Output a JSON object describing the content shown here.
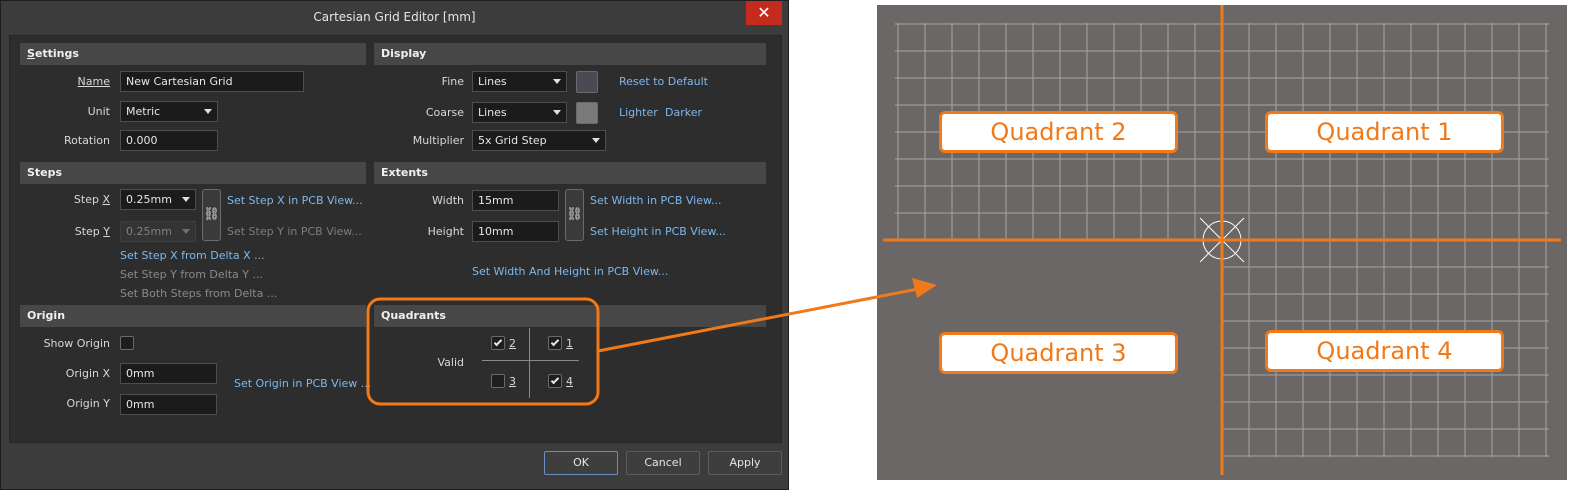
{
  "dialog": {
    "title": "Cartesian Grid Editor [mm]",
    "close_label": "✕"
  },
  "settings": {
    "header": "Settings",
    "name_label": "Name",
    "name_value": "New Cartesian Grid",
    "unit_label": "Unit",
    "unit_value": "Metric",
    "rotation_label": "Rotation",
    "rotation_value": "0.000"
  },
  "display": {
    "header": "Display",
    "fine_label": "Fine",
    "fine_value": "Lines",
    "coarse_label": "Coarse",
    "coarse_value": "Lines",
    "multiplier_label": "Multiplier",
    "multiplier_value": "5x Grid Step",
    "reset_link": "Reset to Default",
    "lighter_link": "Lighter",
    "darker_link": "Darker",
    "fine_color": "#4a4a55",
    "coarse_color": "#7a7a7a"
  },
  "steps": {
    "header": "Steps",
    "step_x_label_prefix": "Step ",
    "step_x_label_key": "X",
    "step_x_value": "0.25mm",
    "step_y_label_prefix": "Step ",
    "step_y_label_key": "Y",
    "step_y_value": "0.25mm",
    "set_x_pcb": "Set Step X in PCB View...",
    "set_y_pcb": "Set Step Y in PCB View...",
    "set_x_delta": "Set Step X from Delta X ...",
    "set_y_delta": "Set Step Y from Delta Y ...",
    "set_both_delta": "Set Both Steps from Delta ..."
  },
  "extents": {
    "header": "Extents",
    "width_label": "Width",
    "width_value": "15mm",
    "height_label": "Height",
    "height_value": "10mm",
    "set_width_pcb": "Set Width in PCB View...",
    "set_height_pcb": "Set Height in PCB View...",
    "set_both_pcb": "Set Width And Height in PCB View..."
  },
  "origin": {
    "header": "Origin",
    "show_label": "Show Origin",
    "show_checked": false,
    "x_label": "Origin X",
    "x_value": "0mm",
    "y_label": "Origin Y",
    "y_value": "0mm",
    "set_pcb": "Set Origin in PCB View ..."
  },
  "quadrants": {
    "header": "Quadrants",
    "valid_label": "Valid",
    "q1": {
      "label": "1",
      "checked": true
    },
    "q2": {
      "label": "2",
      "checked": true
    },
    "q3": {
      "label": "3",
      "checked": false
    },
    "q4": {
      "label": "4",
      "checked": true
    }
  },
  "buttons": {
    "ok": "OK",
    "cancel": "Cancel",
    "apply": "Apply"
  },
  "illustration": {
    "q1": "Quadrant 1",
    "q2": "Quadrant 2",
    "q3": "Quadrant 3",
    "q4": "Quadrant 4",
    "accent_color": "#f07a19"
  }
}
